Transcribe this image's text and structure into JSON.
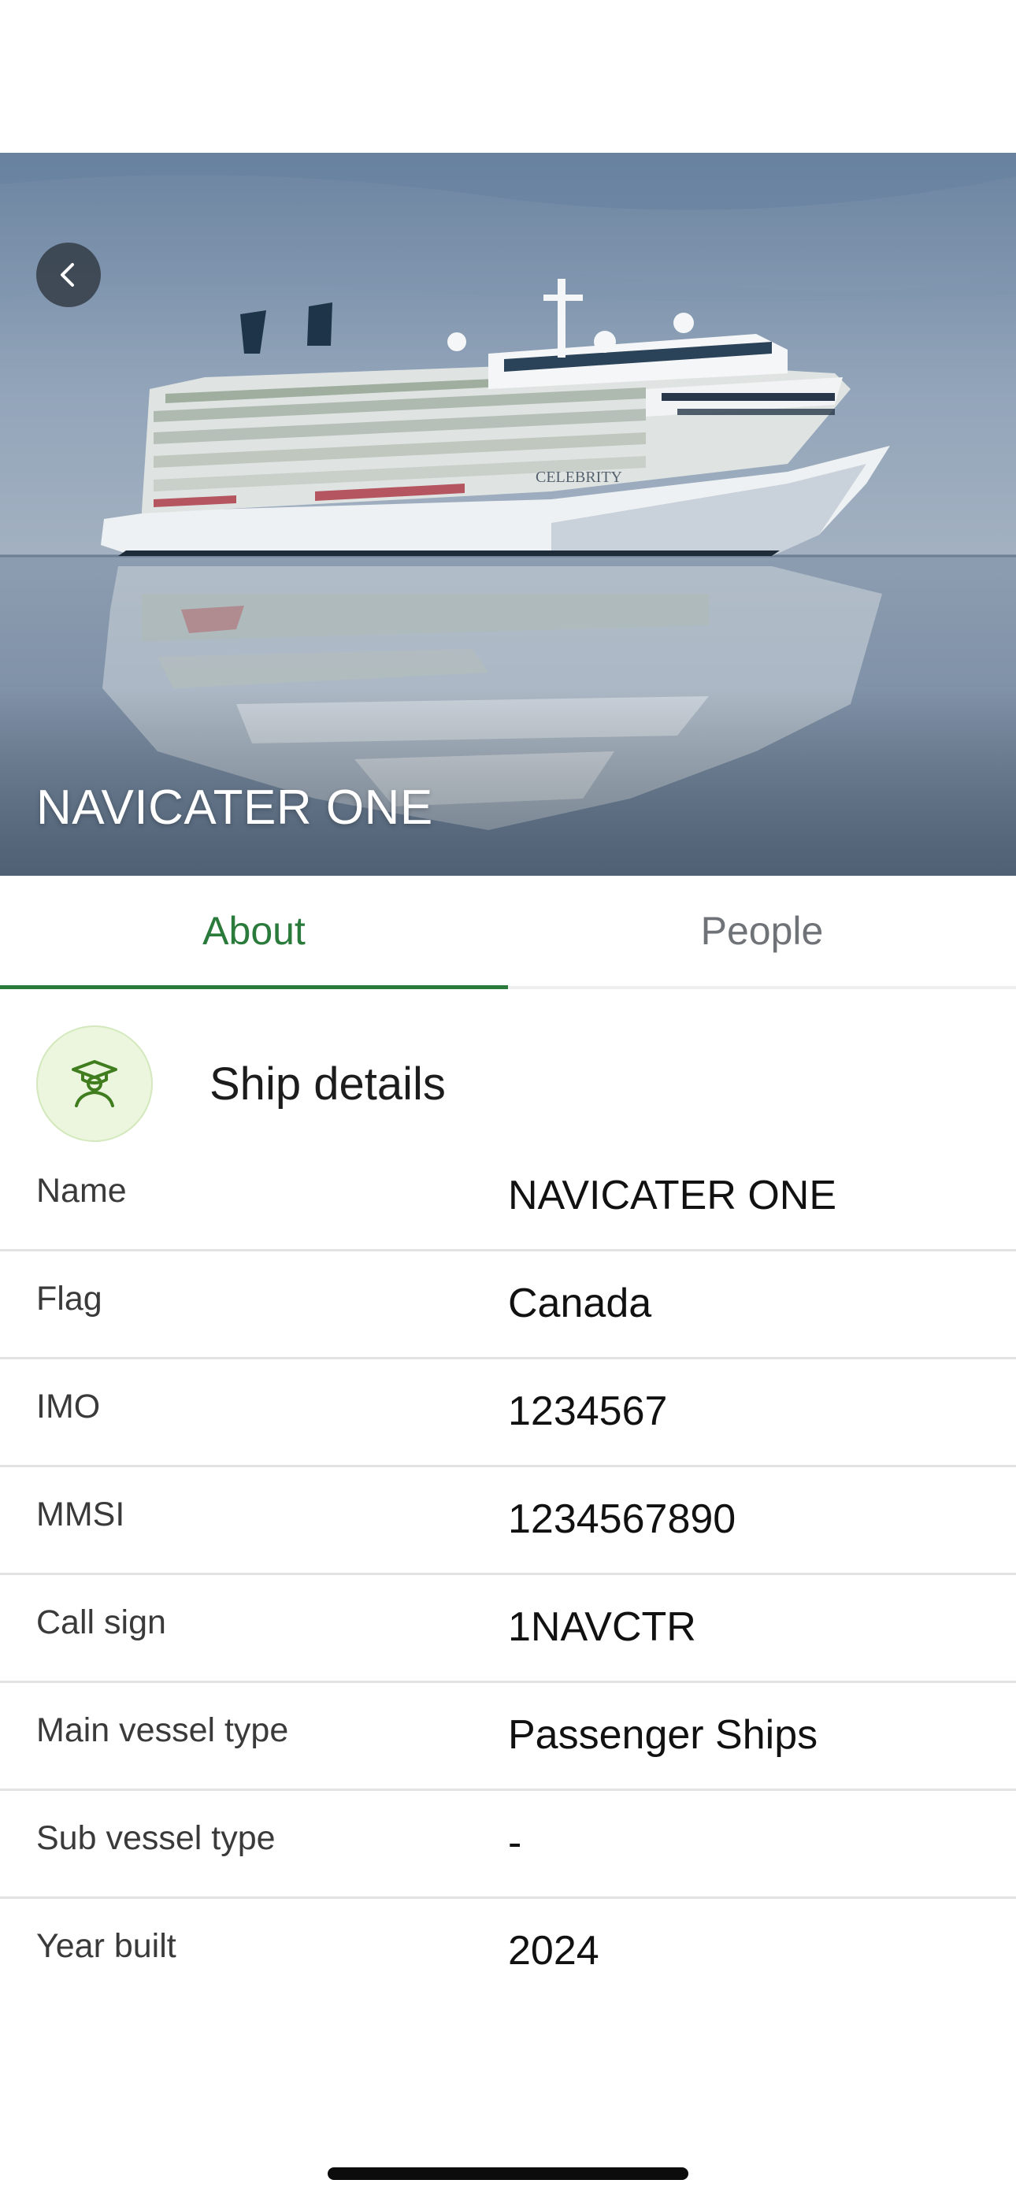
{
  "hero": {
    "title": "NAVICATER ONE",
    "back_icon": "chevron-left-icon",
    "image_subject": "cruise ship at sea"
  },
  "tabs": [
    {
      "label": "About",
      "active": true
    },
    {
      "label": "People",
      "active": false
    }
  ],
  "section": {
    "title": "Ship details",
    "icon": "captain-icon"
  },
  "details": [
    {
      "label": "Name",
      "value": "NAVICATER ONE"
    },
    {
      "label": "Flag",
      "value": "Canada"
    },
    {
      "label": "IMO",
      "value": "1234567"
    },
    {
      "label": "MMSI",
      "value": "1234567890"
    },
    {
      "label": "Call sign",
      "value": "1NAVCTR"
    },
    {
      "label": "Main vessel type",
      "value": "Passenger Ships"
    },
    {
      "label": "Sub vessel type",
      "value": "-"
    },
    {
      "label": "Year built",
      "value": "2024"
    }
  ],
  "colors": {
    "accent": "#2a7a3b",
    "tab_inactive": "#6f7378",
    "icon_bg": "#ecf6de"
  }
}
